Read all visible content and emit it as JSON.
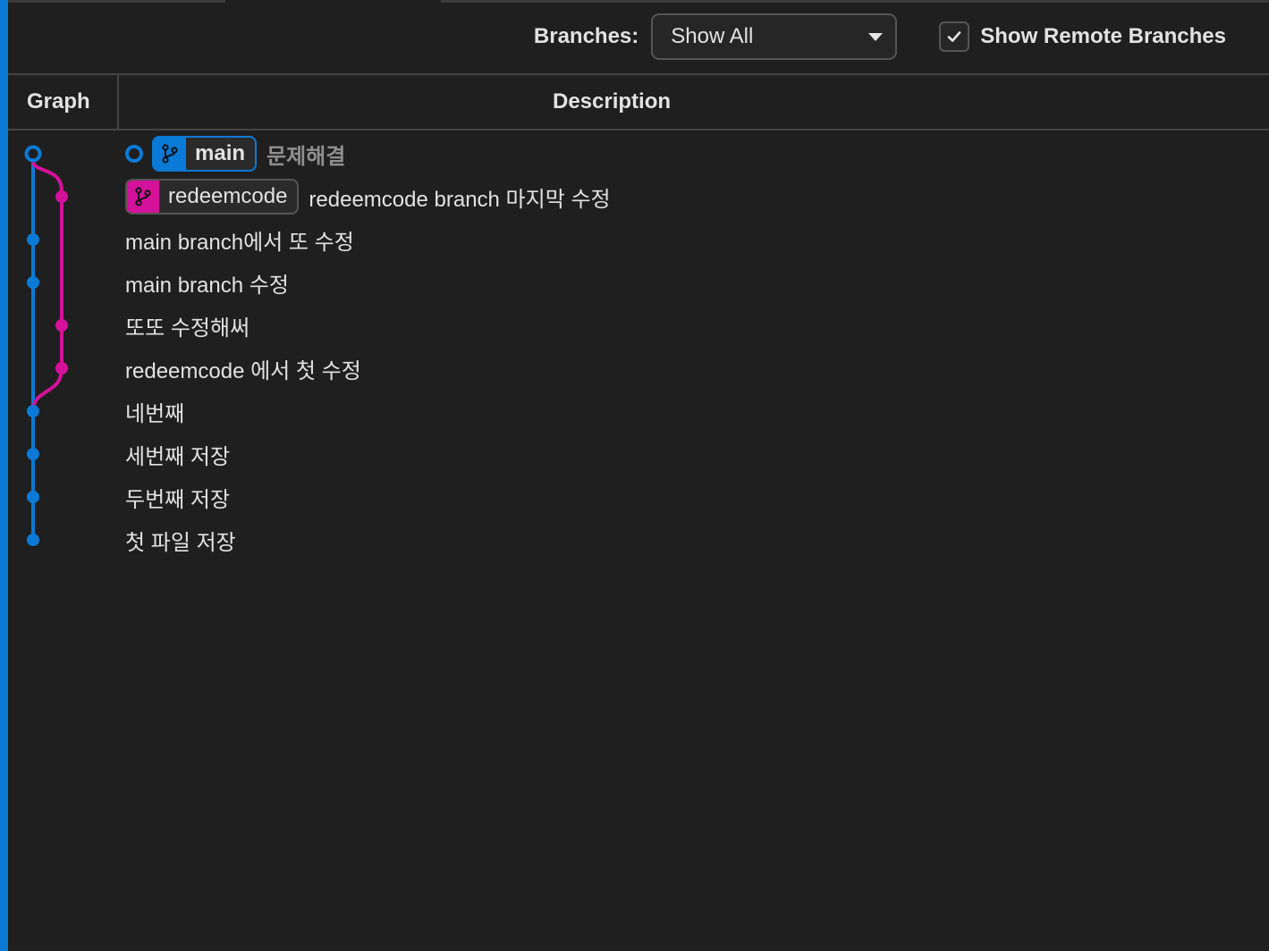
{
  "toolbar": {
    "branches_label": "Branches:",
    "branches_select": {
      "selected": "Show All"
    },
    "show_remote": {
      "label": "Show Remote Branches",
      "checked": true
    }
  },
  "table": {
    "columns": [
      "Graph",
      "Description"
    ]
  },
  "colors": {
    "accent": "#0a7ad6",
    "main_branch": "#0a7ad6",
    "redeemcode_branch": "#d4119a",
    "background": "#1f1f1f"
  },
  "commits": [
    {
      "message": "문제해결",
      "lane": 0,
      "is_head": true,
      "uncommitted": true,
      "branch_tag": "main"
    },
    {
      "message": "redeemcode branch 마지막 수정",
      "lane": 1,
      "branch_tag": "redeemcode"
    },
    {
      "message": "main branch에서 또 수정",
      "lane": 0
    },
    {
      "message": "main branch 수정",
      "lane": 0
    },
    {
      "message": "또또 수정해써",
      "lane": 1
    },
    {
      "message": "redeemcode 에서 첫 수정",
      "lane": 1
    },
    {
      "message": "네번째",
      "lane": 0
    },
    {
      "message": "세번째 저장",
      "lane": 0
    },
    {
      "message": "두번째 저장",
      "lane": 0
    },
    {
      "message": "첫 파일 저장",
      "lane": 0
    }
  ],
  "tags": {
    "main": "main",
    "redeemcode": "redeemcode"
  }
}
